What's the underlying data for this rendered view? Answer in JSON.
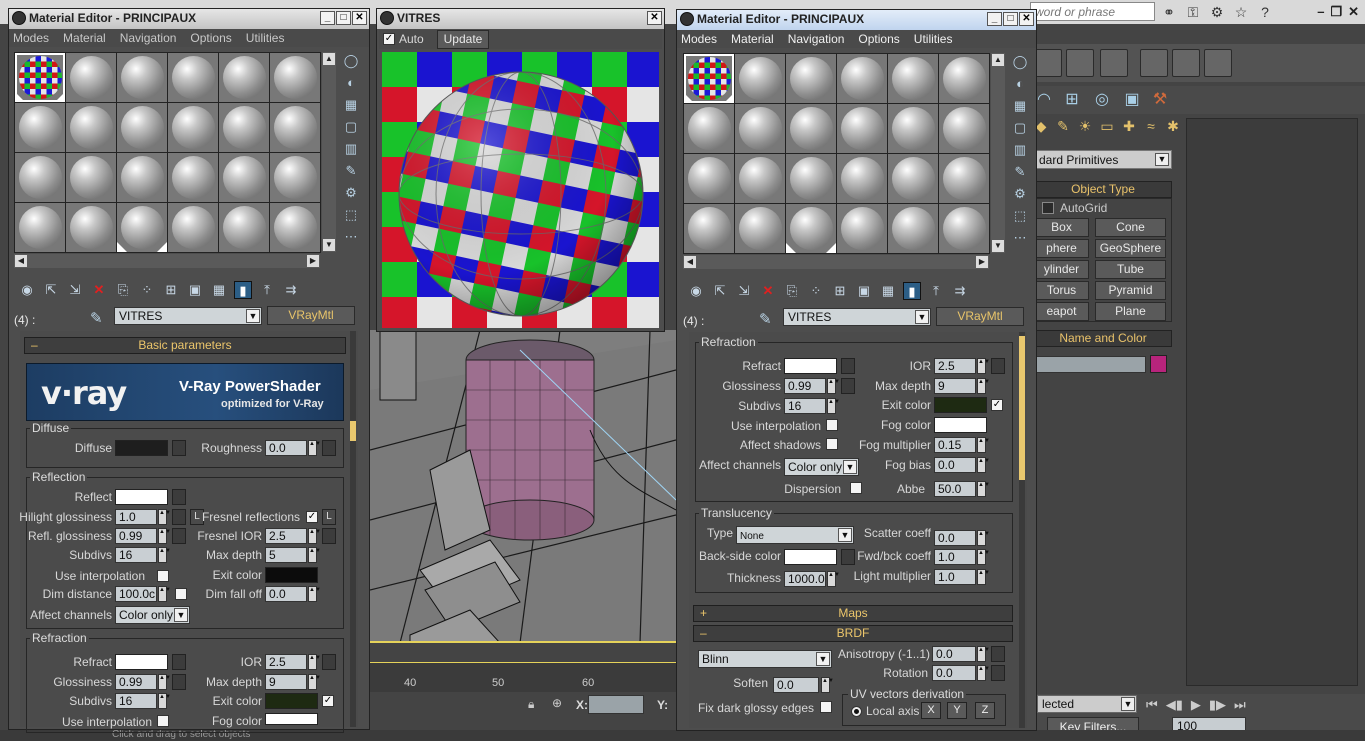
{
  "app": {
    "search_placeholder": "word or phrase",
    "standard_primitives": "dard Primitives",
    "object_type_title": "Object Type",
    "autogrid": "AutoGrid",
    "primitives": [
      "Box",
      "Cone",
      "phere",
      "GeoSphere",
      "ylinder",
      "Tube",
      "Torus",
      "Pyramid",
      "eapot",
      "Plane"
    ],
    "name_color_title": "Name and Color",
    "name_color_hex": "#b8247c",
    "ruler_ticks": [
      "40",
      "50",
      "60"
    ],
    "coord_x": "X:",
    "coord_y": "Y:",
    "selection_dd": "lected",
    "key_filters": "Key Filters...",
    "frame_value": "100",
    "status_text": "Click and drag to select objects"
  },
  "editor_left": {
    "title": "Material Editor - PRINCIPAUX",
    "menu": [
      "Modes",
      "Material",
      "Navigation",
      "Options",
      "Utilities"
    ],
    "slot_label": "(4) :",
    "material_name": "VITRES",
    "material_type": "VRayMtl",
    "basic_params": "Basic parameters",
    "banner_logo": "v·ray",
    "banner_title": "V-Ray PowerShader",
    "banner_subtitle": "optimized for V-Ray",
    "diffuse": {
      "group": "Diffuse",
      "label": "Diffuse",
      "roughness_label": "Roughness",
      "roughness": "0.0",
      "color_hex": "#1e1e1e"
    },
    "reflection": {
      "group": "Reflection",
      "reflect": "Reflect",
      "reflect_hex": "#ffffff",
      "hilight_label": "Hilight glossiness",
      "hilight": "1.0",
      "l_btn": "L",
      "fresnel_label": "Fresnel reflections",
      "refl_gloss_label": "Refl. glossiness",
      "refl_gloss": "0.99",
      "fresnel_ior_label": "Fresnel IOR",
      "fresnel_ior": "2.5",
      "subdivs_label": "Subdivs",
      "subdivs": "16",
      "max_depth_label": "Max depth",
      "max_depth": "5",
      "use_interp": "Use interpolation",
      "exit_color": "Exit color",
      "exit_hex": "#0c0c0c",
      "dim_distance_label": "Dim distance",
      "dim_distance": "100.0c",
      "dim_falloff_label": "Dim fall off",
      "dim_falloff": "0.0",
      "affect_channels": "Affect channels",
      "affect_value": "Color only"
    },
    "refraction": {
      "group": "Refraction",
      "refract": "Refract",
      "refract_hex": "#ffffff",
      "ior_label": "IOR",
      "ior": "2.5",
      "gloss_label": "Glossiness",
      "gloss": "0.99",
      "max_depth_label": "Max depth",
      "max_depth": "9",
      "subdivs_label": "Subdivs",
      "subdivs": "16",
      "exit_color": "Exit color",
      "exit_hex": "#1e2a12",
      "use_interp": "Use interpolation",
      "fog_color": "Fog color"
    }
  },
  "vitres": {
    "title": "VITRES",
    "auto": "Auto",
    "update": "Update"
  },
  "editor_right": {
    "title": "Material Editor - PRINCIPAUX",
    "menu": [
      "Modes",
      "Material",
      "Navigation",
      "Options",
      "Utilities"
    ],
    "slot_label": "(4) :",
    "material_name": "VITRES",
    "material_type": "VRayMtl",
    "refraction": {
      "group": "Refraction",
      "refract": "Refract",
      "refract_hex": "#ffffff",
      "ior_label": "IOR",
      "ior": "2.5",
      "gloss_label": "Glossiness",
      "gloss": "0.99",
      "max_depth_label": "Max depth",
      "max_depth": "9",
      "subdivs_label": "Subdivs",
      "subdivs": "16",
      "exit_color": "Exit color",
      "exit_hex": "#1e2a12",
      "use_interp": "Use interpolation",
      "fog_color": "Fog color",
      "fog_hex": "#ffffff",
      "affect_shadows": "Affect shadows",
      "fog_mult_label": "Fog multiplier",
      "fog_mult": "0.15",
      "affect_channels": "Affect channels",
      "affect_value": "Color only",
      "fog_bias_label": "Fog bias",
      "fog_bias": "0.0",
      "dispersion": "Dispersion",
      "abbe_label": "Abbe",
      "abbe": "50.0"
    },
    "translucency": {
      "group": "Translucency",
      "type_label": "Type",
      "type_value": "None",
      "scatter_label": "Scatter coeff",
      "scatter": "0.0",
      "backside_label": "Back-side color",
      "backside_hex": "#ffffff",
      "fwdbck_label": "Fwd/bck coeff",
      "fwdbck": "1.0",
      "thickness_label": "Thickness",
      "thickness": "1000.0",
      "light_mult_label": "Light multiplier",
      "light_mult": "1.0"
    },
    "maps": "Maps",
    "brdf": {
      "title": "BRDF",
      "type": "Blinn",
      "aniso_label": "Anisotropy (-1..1)",
      "aniso": "0.0",
      "rotation_label": "Rotation",
      "rotation": "0.0",
      "soften_label": "Soften",
      "soften": "0.0",
      "uv_group": "UV vectors derivation",
      "fix_dark": "Fix dark glossy edges",
      "local_axis": "Local axis",
      "x": "X",
      "y": "Y",
      "z": "Z"
    }
  }
}
